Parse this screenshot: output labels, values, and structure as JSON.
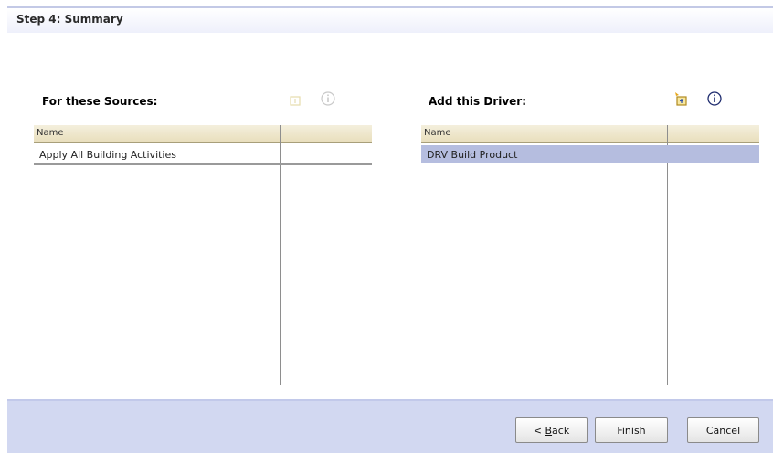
{
  "step": {
    "title": "Step 4: Summary"
  },
  "sources": {
    "title": "For these Sources:",
    "icons": {
      "add": "add-source-icon",
      "info": "info-icon"
    },
    "columns": [
      "Name",
      ""
    ],
    "rows": [
      {
        "name": "Apply All Building Activities",
        "selected": false
      }
    ]
  },
  "driver": {
    "title": "Add this Driver:",
    "icons": {
      "add": "add-driver-icon",
      "info": "info-icon"
    },
    "columns": [
      "Name",
      ""
    ],
    "rows": [
      {
        "name": "DRV Build Product",
        "selected": true
      }
    ]
  },
  "footer": {
    "back_prefix": "< ",
    "back_mnemonic": "B",
    "back_rest": "ack",
    "finish_label": "Finish",
    "cancel_label": "Cancel"
  },
  "colors": {
    "header_band": "#eef0fb",
    "footer_band": "#d2d8f1",
    "selection": "#b5bddf",
    "grid_header": "#e9dfbd"
  }
}
